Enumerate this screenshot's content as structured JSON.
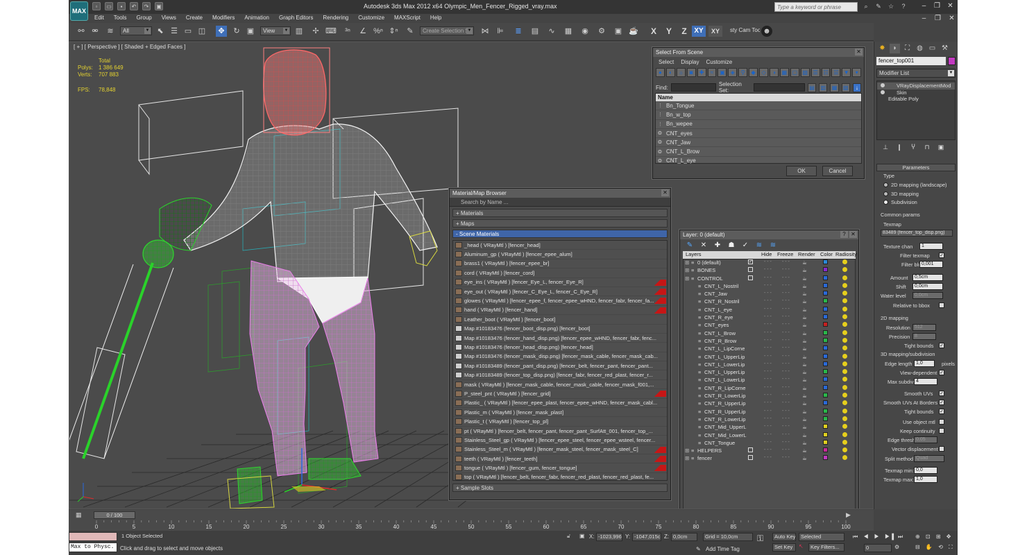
{
  "app": {
    "logo": "MAX",
    "title": "Autodesk 3ds Max  2012 x64     Olympic_Men_Fencer_Rigged_vray.max",
    "search_placeholder": "Type a keyword or phrase"
  },
  "menu": [
    "Edit",
    "Tools",
    "Group",
    "Views",
    "Create",
    "Modifiers",
    "Animation",
    "Graph Editors",
    "Rendering",
    "Customize",
    "MAXScript",
    "Help"
  ],
  "toolbar": {
    "filter_value": "All",
    "refcoord_value": "View",
    "selection_set_placeholder": "Create Selection Se",
    "axes": [
      "X",
      "Y",
      "Z",
      "XY",
      "XY"
    ],
    "custom_tool": "sty Cam Tool v"
  },
  "viewport": {
    "label": "[ + ] [ Perspective ] [ Shaded + Edged Faces ]",
    "stats": {
      "total_label": "Total",
      "polys_label": "Polys:",
      "polys": "1 386 649",
      "verts_label": "Verts:",
      "verts": "707 883",
      "fps_label": "FPS:",
      "fps": "78,848"
    }
  },
  "select_from_scene": {
    "title": "Select From Scene",
    "menu": [
      "Select",
      "Display",
      "Customize"
    ],
    "find_label": "Find:",
    "selection_set_label": "Selection Set:",
    "column_name": "Name",
    "rows": [
      "Bn_Tongue",
      "Bn_w_top",
      "Bn_wepee",
      "CNT_eyes",
      "CNT_Jaw",
      "CNT_L_Brow",
      "CNT_L_eye"
    ],
    "ok": "OK",
    "cancel": "Cancel"
  },
  "material_browser": {
    "title": "Material/Map Browser",
    "search_placeholder": "Search by Name ...",
    "sections": [
      "+ Materials",
      "+ Maps",
      "- Scene Materials"
    ],
    "footer": "+ Sample Slots",
    "items": [
      {
        "text": "_head  ( VRayMtl )  [fencer_head]",
        "map": false,
        "red": false
      },
      {
        "text": "Aluminum_gp  ( VRayMtl )  [fencer_epee_alum]",
        "map": false,
        "red": false
      },
      {
        "text": "brass1  ( VRayMtl )  [fencer_epee_br]",
        "map": false,
        "red": false
      },
      {
        "text": "cord  ( VRayMtl )  [fencer_cord]",
        "map": false,
        "red": false
      },
      {
        "text": "eye_ins  ( VRayMtl )  [fencer_Eye_L, fencer_Eye_R]",
        "map": false,
        "red": true
      },
      {
        "text": "eye_out  ( VRayMtl )  [fencer_C_Eye_L, fencer_C_Eye_R]",
        "map": false,
        "red": true
      },
      {
        "text": "glowes  ( VRayMtl )  [fencer_epee_f, fencer_epee_wHND, fencer_fabr, fencer_fa...",
        "map": false,
        "red": true
      },
      {
        "text": "hand  ( VRayMtl )  [fencer_hand]",
        "map": false,
        "red": true
      },
      {
        "text": "Leather_boot  ( VRayMtl )  [fencer_boot]",
        "map": false,
        "red": false
      },
      {
        "text": "Map #10183476 (fencer_boot_disp.png)  [fencer_boot]",
        "map": true,
        "red": false
      },
      {
        "text": "Map #10183476 (fencer_hand_disp.png)  [fencer_epee_wHND, fencer_fabr, fenc...",
        "map": true,
        "red": false
      },
      {
        "text": "Map #10183476 (fencer_head_disp.png)  [fencer_head]",
        "map": true,
        "red": false
      },
      {
        "text": "Map #10183476 (fencer_mask_disp.png)  [fencer_mask_cable, fencer_mask_cab...",
        "map": true,
        "red": false
      },
      {
        "text": "Map #10183489 (fencer_pant_disp.png)  [fencer_belt, fencer_pant, fencer_pant...",
        "map": true,
        "red": false
      },
      {
        "text": "Map #10183489 (fencer_top_disp.png)  [fencer_fabr, fencer_red_plast, fencer_r...",
        "map": true,
        "red": false
      },
      {
        "text": "mask  ( VRayMtl )  [fencer_mask_cable, fencer_mask_cable, fencer_mask_f001,...",
        "map": false,
        "red": false
      },
      {
        "text": "P_steel_pnt  ( VRayMtl )  [fencer_grid]",
        "map": false,
        "red": true
      },
      {
        "text": "Plastic_  ( VRayMtl )  [fencer_epee_plast, fencer_epee_wHND, fencer_mask_cabl...",
        "map": false,
        "red": false
      },
      {
        "text": "Plastic_m  ( VRayMtl )  [fencer_mask_plast]",
        "map": false,
        "red": false
      },
      {
        "text": "Plastic_t  ( VRayMtl )  [fencer_top_pl]",
        "map": false,
        "red": false
      },
      {
        "text": "pt  ( VRayMtl )  [fencer_belt, fencer_pant, fencer_pant_SurfAtt_001, fencer_top_...",
        "map": false,
        "red": false
      },
      {
        "text": "Stainless_Steel_gp  ( VRayMtl )  [fencer_epee_steel, fencer_epee_wsteel, fencer...",
        "map": false,
        "red": false
      },
      {
        "text": "Stainless_Steel_m  ( VRayMtl )  [fencer_mask_steel, fencer_mask_steel_C]",
        "map": false,
        "red": true
      },
      {
        "text": "teeth  ( VRayMtl )  [fencer_teeth]",
        "map": false,
        "red": true
      },
      {
        "text": "tongue  ( VRayMtl )  [fencer_gum, fencer_tongue]",
        "map": false,
        "red": true
      },
      {
        "text": "top  ( VRayMtl )  [fencer_belt, fencer_fabr, fencer_red_plast, fencer_red_plast, fe...",
        "map": false,
        "red": false
      }
    ]
  },
  "layer_manager": {
    "title": "Layer: 0 (default)",
    "columns": [
      "Layers",
      "Hide",
      "Freeze",
      "Render",
      "Color",
      "Radiosity"
    ],
    "rows": [
      {
        "name": "0 (default)",
        "level": 0,
        "check": true,
        "color": "#2a8ad8"
      },
      {
        "name": "BONES",
        "level": 0,
        "check": false,
        "color": "#8a2ad0"
      },
      {
        "name": "CONTROL",
        "level": 0,
        "check": false,
        "color": "#2a6ad8"
      },
      {
        "name": "CNT_L_Nostril",
        "level": 1,
        "check": false,
        "color": "#2a6ad8"
      },
      {
        "name": "CNT_Jaw",
        "level": 1,
        "check": false,
        "color": "#2a6ad8"
      },
      {
        "name": "CNT_R_Nostril",
        "level": 1,
        "check": false,
        "color": "#2ab84a"
      },
      {
        "name": "CNT_L_eye",
        "level": 1,
        "check": false,
        "color": "#2a6ad8"
      },
      {
        "name": "CNT_R_eye",
        "level": 1,
        "check": false,
        "color": "#2a6ad8"
      },
      {
        "name": "CNT_eyes",
        "level": 1,
        "check": false,
        "color": "#c82020"
      },
      {
        "name": "CNT_L_Brow",
        "level": 1,
        "check": false,
        "color": "#2ab84a"
      },
      {
        "name": "CNT_R_Brow",
        "level": 1,
        "check": false,
        "color": "#2ab84a"
      },
      {
        "name": "CNT_L_LipCorne",
        "level": 1,
        "check": false,
        "color": "#2a6ad8"
      },
      {
        "name": "CNT_L_UpperLip",
        "level": 1,
        "check": false,
        "color": "#2a6ad8"
      },
      {
        "name": "CNT_L_LowerLip",
        "level": 1,
        "check": false,
        "color": "#2a6ad8"
      },
      {
        "name": "CNT_L_UpperLip",
        "level": 1,
        "check": false,
        "color": "#2ab84a"
      },
      {
        "name": "CNT_L_LowerLip",
        "level": 1,
        "check": false,
        "color": "#2a6ad8"
      },
      {
        "name": "CNT_R_LipCorne",
        "level": 1,
        "check": false,
        "color": "#2a6ad8"
      },
      {
        "name": "CNT_R_LowerLip",
        "level": 1,
        "check": false,
        "color": "#2ab84a"
      },
      {
        "name": "CNT_R_UpperLip",
        "level": 1,
        "check": false,
        "color": "#2a6ad8"
      },
      {
        "name": "CNT_R_UpperLip",
        "level": 1,
        "check": false,
        "color": "#2ab84a"
      },
      {
        "name": "CNT_R_LowerLip",
        "level": 1,
        "check": false,
        "color": "#2ab84a"
      },
      {
        "name": "CNT_Mid_UpperL",
        "level": 1,
        "check": false,
        "color": "#e0d020"
      },
      {
        "name": "CNT_Mid_LowerL",
        "level": 1,
        "check": false,
        "color": "#e0d020"
      },
      {
        "name": "CNT_Tongue",
        "level": 1,
        "check": false,
        "color": "#e0d020"
      },
      {
        "name": "HELPERS",
        "level": 0,
        "check": false,
        "color": "#c82a9a"
      },
      {
        "name": "fencer",
        "level": 0,
        "check": false,
        "color": "#c23ac0"
      }
    ]
  },
  "command_panel": {
    "object_name": "fencer_top001",
    "object_color": "#c23ac0",
    "modifier_list": "Modifier List",
    "stack": [
      "VRayDisplacementMod",
      "Skin",
      "Editable Poly"
    ],
    "parameters": {
      "title": "Parameters",
      "type_label": "Type",
      "type_options": [
        "2D mapping (landscape)",
        "3D mapping",
        "Subdivision"
      ],
      "selected_type_index": 2,
      "common_params": "Common params",
      "texmap_label": "Texmap",
      "texmap_value": "83489 (fencer_top_disp.png)",
      "texture_chan_label": "Texture chan",
      "texture_chan_value": "1",
      "filter_texmap_label": "Filter texmap",
      "filter_blur_label": "Filter blur",
      "filter_blur_value": "0,001",
      "amount_label": "Amount",
      "amount_value": "0,5cm",
      "shift_label": "Shift",
      "shift_value": "0,0cm",
      "water_level_label": "Water level",
      "water_level_value": "0,0cm",
      "relative_bbox_label": "Relative to bbox",
      "mapping2d_label": "2D mapping",
      "resolution_label": "Resolution",
      "resolution_value": "512",
      "precision_label": "Precision",
      "precision_value": "8",
      "tight_bounds_label": "Tight bounds",
      "mapping3d_label": "3D mapping/subdivision",
      "edge_length_label": "Edge length",
      "edge_length_value": "1,0",
      "pixels_label": "pixels",
      "view_dependent_label": "View-dependent",
      "max_subdivs_label": "Max subdivs",
      "max_subdivs_value": "4",
      "smooth_uvs_label": "Smooth UVs",
      "smooth_uvs_borders_label": "Smooth UVs At Borders",
      "tight_bounds2_label": "Tight bounds",
      "use_object_mtl_label": "Use object mtl",
      "keep_continuity_label": "Keep continuity",
      "edge_thresh_label": "Edge thresh",
      "edge_thresh_value": "0,05",
      "vector_displacement_label": "Vector displacement",
      "split_method_label": "Split method",
      "split_method_value": "Quad",
      "texmap_min_label": "Texmap min:",
      "texmap_min_value": "0,0",
      "texmap_max_label": "Texmap max:",
      "texmap_max_value": "1,0"
    }
  },
  "timeline": {
    "slider": "0 / 100",
    "ticks": [
      "0",
      "5",
      "10",
      "15",
      "20",
      "25",
      "30",
      "35",
      "40",
      "45",
      "50",
      "55",
      "60",
      "65",
      "70",
      "75",
      "80",
      "85",
      "90",
      "95",
      "100"
    ]
  },
  "status": {
    "maxscript": "Max to Physc.",
    "selected": "1 Object Selected",
    "prompt": "Click and drag to select and move objects",
    "x_label": "X:",
    "x_value": "-1023,996",
    "y_label": "Y:",
    "y_value": "-1047,015c",
    "z_label": "Z:",
    "z_value": "0,0cm",
    "grid": "Grid = 10,0cm",
    "add_time_tag": "Add Time Tag",
    "auto_key": "Auto Key",
    "set_key": "Set Key",
    "key_mode": "Selected",
    "key_filters": "Key Filters...",
    "frame": "0"
  }
}
